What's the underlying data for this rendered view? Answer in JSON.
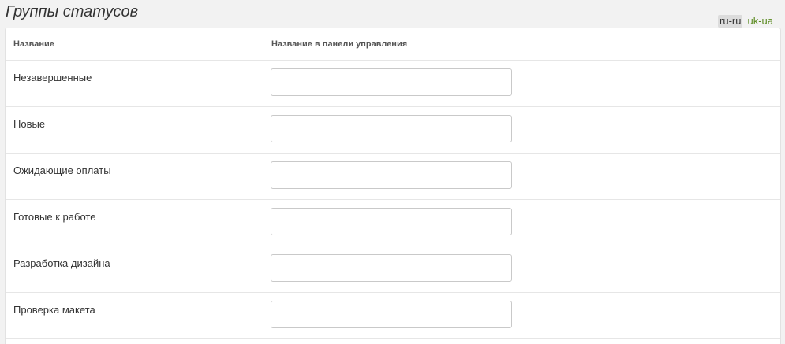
{
  "page": {
    "title": "Группы статусов"
  },
  "languages": [
    {
      "code": "ru-ru",
      "active": true
    },
    {
      "code": "uk-ua",
      "active": false
    }
  ],
  "table": {
    "headers": {
      "name": "Название",
      "panel_name": "Название в панели управления"
    },
    "rows": [
      {
        "name": "Незавершенные",
        "value": ""
      },
      {
        "name": "Новые",
        "value": ""
      },
      {
        "name": "Ожидающие оплаты",
        "value": ""
      },
      {
        "name": "Готовые к работе",
        "value": ""
      },
      {
        "name": "Разработка дизайна",
        "value": ""
      },
      {
        "name": "Проверка макета",
        "value": ""
      }
    ]
  },
  "colors": {
    "accent_link": "#5a8a1f",
    "active_lang_bg": "#dcdcdc"
  }
}
